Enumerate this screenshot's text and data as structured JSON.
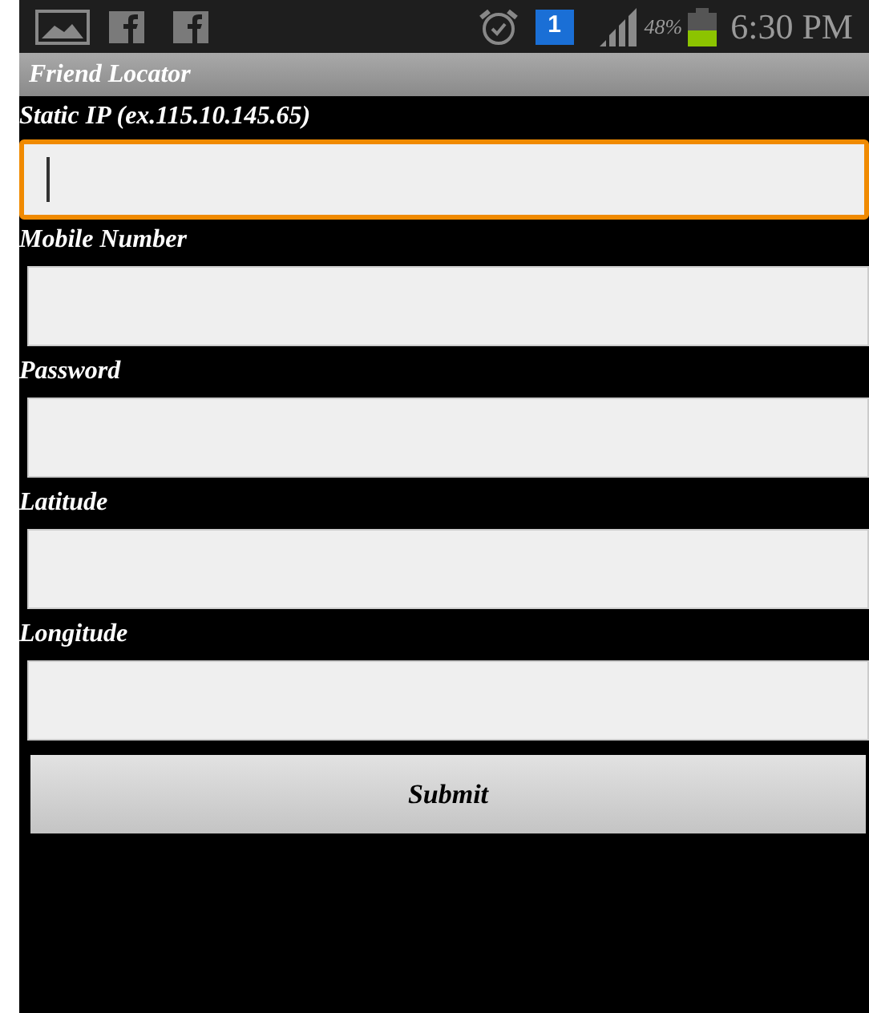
{
  "status_bar": {
    "badge": "1",
    "battery": "48%",
    "time": "6:30 PM"
  },
  "title": "Friend Locator",
  "fields": [
    {
      "label": "Static IP (ex.115.10.145.65)",
      "focused": true
    },
    {
      "label": "Mobile Number",
      "focused": false
    },
    {
      "label": "Password",
      "focused": false
    },
    {
      "label": "Latitude",
      "focused": false
    },
    {
      "label": "Longitude",
      "focused": false
    }
  ],
  "button": "Submit"
}
